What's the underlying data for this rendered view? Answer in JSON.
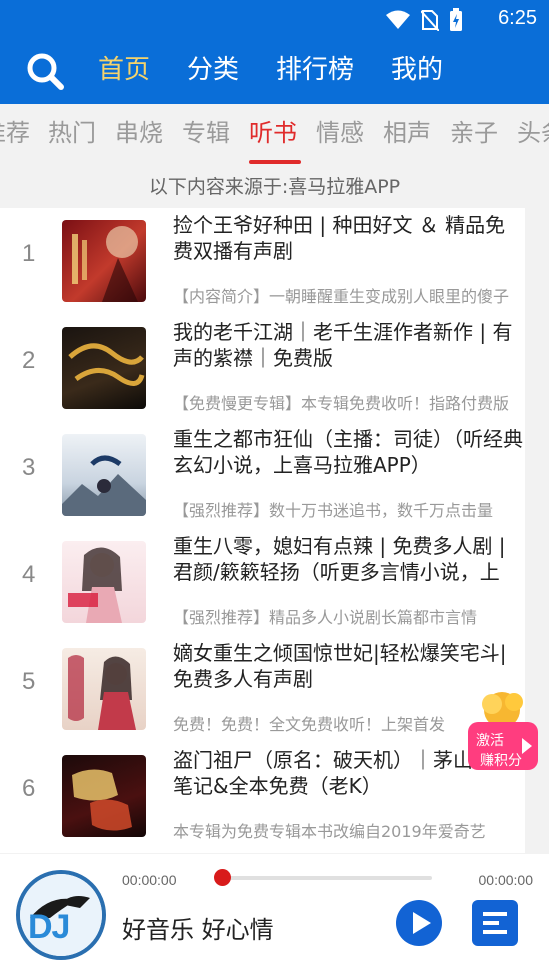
{
  "status_bar": {
    "time": "6:25"
  },
  "header": {
    "nav": [
      {
        "label": "首页",
        "active": true
      },
      {
        "label": "分类",
        "active": false
      },
      {
        "label": "排行榜",
        "active": false
      },
      {
        "label": "我的",
        "active": false
      }
    ]
  },
  "tabs": [
    {
      "label": "推荐"
    },
    {
      "label": "热门"
    },
    {
      "label": "串烧"
    },
    {
      "label": "专辑"
    },
    {
      "label": "听书",
      "active": true
    },
    {
      "label": "情感"
    },
    {
      "label": "相声"
    },
    {
      "label": "亲子"
    },
    {
      "label": "头条"
    }
  ],
  "source_text": "以下内容来源于:喜马拉雅APP",
  "items": [
    {
      "num": "1",
      "title": "捡个王爷好种田 | 种田好文 ＆ 精品免费双播有声剧",
      "desc": "【内容简介】一朝睡醒重生变成别人眼里的傻子"
    },
    {
      "num": "2",
      "title": "我的老千江湖｜老千生涯作者新作 | 有声的紫襟｜免费版",
      "desc": "【免费慢更专辑】本专辑免费收听！指路付费版"
    },
    {
      "num": "3",
      "title": "重生之都市狂仙（主播：司徒）（听经典玄幻小说，上喜马拉雅APP）",
      "desc": "【强烈推荐】数十万书迷追书，数千万点击量"
    },
    {
      "num": "4",
      "title": "重生八零，媳妇有点辣 | 免费多人剧 | 君颜/簌簌轻扬（听更多言情小说，上",
      "desc": "【强烈推荐】精品多人小说剧长篇都市言情"
    },
    {
      "num": "5",
      "title": "嫡女重生之倾国惊世妃|轻松爆笑宅斗|免费多人有声剧",
      "desc": "免费！免费！全文免费收听！上架首发"
    },
    {
      "num": "6",
      "title": "盗门祖尸（原名：破天机）｜茅山盗墓笔记&全本免费（老K）",
      "desc": "本专辑为免费专辑本书改编自2019年爱奇艺"
    }
  ],
  "player": {
    "time_start": "00:00:00",
    "time_end": "00:00:00",
    "progress": 0,
    "song": "好音乐 好心情",
    "avatar_text": "DJ"
  },
  "promo": {
    "line1": "激活",
    "line2": "赚积分"
  },
  "colors": {
    "primary": "#0a6ed8",
    "accent_red": "#e02b2b",
    "nav_active": "#f5d36b"
  }
}
